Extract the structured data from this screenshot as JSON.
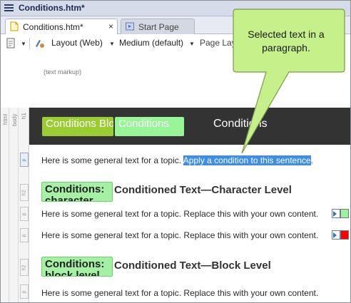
{
  "window": {
    "title": "Conditions.htm*"
  },
  "tabs": [
    {
      "label": "Conditions.htm*",
      "close": "×"
    },
    {
      "label": "Start Page",
      "close": ""
    }
  ],
  "toolbar": {
    "layout_label": "Layout (Web)",
    "medium_label": "Medium (default)",
    "page_layout_label": "Page Lay",
    "text_markup_label": "(text markup)"
  },
  "gutter": {
    "html": "html",
    "body": "body",
    "h1": "h1",
    "p": "p",
    "h2": "h2"
  },
  "h1": {
    "badge1": "Conditions BlockFle",
    "badge2": "Conditions",
    "text": "Conditions"
  },
  "para1": {
    "plain": "Here is some general text for a topic. ",
    "selected": "Apply a condition to this sentence",
    "end": "."
  },
  "h2a": {
    "badge": "Conditions: character",
    "text": "Conditioned Text—Character Level"
  },
  "para2": {
    "text": "Here is some general text for a topic. Replace this with your own content."
  },
  "para3": {
    "text": "Here is some general text for a topic. Replace this with your own content."
  },
  "h2b": {
    "badge": "Conditions: block level",
    "text": "Conditioned Text—Block Level"
  },
  "para4": {
    "text": "Here is some general text for a topic. Replace this with your own content."
  },
  "callout": {
    "text": "Selected text in a paragraph."
  },
  "colors": {
    "condition_green": "#9acd32",
    "condition_light_green": "#98f598",
    "condition_red": "#ff0000",
    "selection_blue": "#3f8ee6",
    "callout_fill": "#c6f08a"
  }
}
